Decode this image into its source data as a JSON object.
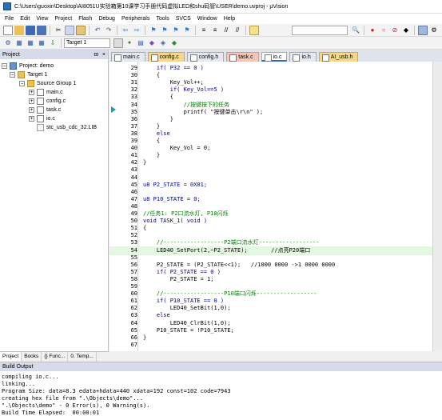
{
  "window": {
    "title": "C:\\Users\\guoxin\\Desktop\\AI8051U实验箱第10课学习手册代码虚拟LED和shu码管\\USER\\demo.uvproj - µVision"
  },
  "menu": [
    "File",
    "Edit",
    "View",
    "Project",
    "Flash",
    "Debug",
    "Peripherals",
    "Tools",
    "SVCS",
    "Window",
    "Help"
  ],
  "toolbar": {
    "target": "Target 1"
  },
  "project_panel": {
    "title": "Project",
    "pin": "ϖ",
    "close": "×",
    "root": "Project: demo",
    "target": "Target 1",
    "group": "Source Group 1",
    "files": [
      "main.c",
      "config.c",
      "task.c",
      "io.c",
      "stc_usb_cdc_32.LIB"
    ],
    "tabs": [
      "Project",
      "Books",
      "{} Func...",
      "0. Temp..."
    ]
  },
  "editor": {
    "tabs": [
      {
        "label": "main.c",
        "color": "#e6e8f0"
      },
      {
        "label": "config.c",
        "color": "#f7d88a"
      },
      {
        "label": "config.h",
        "color": "#e6e8f0"
      },
      {
        "label": "task.c",
        "color": "#f5c6b8"
      },
      {
        "label": "io.c",
        "color": "#ffffff"
      },
      {
        "label": "io.h",
        "color": "#e6e8f0"
      },
      {
        "label": "AI_usb.h",
        "color": "#f7d88a"
      }
    ],
    "lines": [
      {
        "n": "29",
        "t": "    if( P32 == 0 )"
      },
      {
        "n": "30",
        "t": "    {"
      },
      {
        "n": "31",
        "t": "        Key_Vol++;"
      },
      {
        "n": "32",
        "t": "        if( Key_Vol==5 )"
      },
      {
        "n": "33",
        "t": "        {"
      },
      {
        "n": "34",
        "t": "            //按键按下的任务"
      },
      {
        "n": "35",
        "t": "            printf( \"按键单击\\r\\n\" );"
      },
      {
        "n": "36",
        "t": "        }"
      },
      {
        "n": "37",
        "t": "    }"
      },
      {
        "n": "38",
        "t": "    else"
      },
      {
        "n": "39",
        "t": "    {"
      },
      {
        "n": "40",
        "t": "        Key_Vol = 0;"
      },
      {
        "n": "41",
        "t": "    }"
      },
      {
        "n": "42",
        "t": "}"
      },
      {
        "n": "43",
        "t": ""
      },
      {
        "n": "44",
        "t": ""
      },
      {
        "n": "45",
        "t": "u8 P2_STATE = 0X01;"
      },
      {
        "n": "46",
        "t": ""
      },
      {
        "n": "47",
        "t": "u8 P10_STATE = 0;"
      },
      {
        "n": "48",
        "t": ""
      },
      {
        "n": "49",
        "t": "//任务1: P2口流水灯, P10闪烁"
      },
      {
        "n": "50",
        "t": "void TASK_1( void )"
      },
      {
        "n": "51",
        "t": "{"
      },
      {
        "n": "52",
        "t": ""
      },
      {
        "n": "53",
        "t": "    //------------------P2端口流水灯------------------"
      },
      {
        "n": "54",
        "t": "    LED40_SetPort(2,~P2_STATE);       //点亮P20端口"
      },
      {
        "n": "55",
        "t": ""
      },
      {
        "n": "56",
        "t": "    P2_STATE = (P2_STATE<<1);   //1000 0000 ->1 0000 0000"
      },
      {
        "n": "57",
        "t": "    if( P2_STATE == 0 )"
      },
      {
        "n": "58",
        "t": "        P2_STATE = 1;"
      },
      {
        "n": "59",
        "t": ""
      },
      {
        "n": "60",
        "t": "    //------------------P10端口闪烁------------------"
      },
      {
        "n": "61",
        "t": "    if( P10_STATE == 0 )"
      },
      {
        "n": "62",
        "t": "        LED40_SetBit(1,0);"
      },
      {
        "n": "63",
        "t": "    else"
      },
      {
        "n": "64",
        "t": "        LED40_ClrBit(1,0);"
      },
      {
        "n": "65",
        "t": "    P10_STATE = !P10_STATE;"
      },
      {
        "n": "66",
        "t": "}"
      },
      {
        "n": "67",
        "t": ""
      }
    ]
  },
  "build_output": {
    "title": "Build Output",
    "lines": [
      "compiling io.c...",
      "linking...",
      "Program Size: data=8.3 edata+hdata=440 xdata=192 const=102 code=7943",
      "creating hex file from \".\\Objects\\demo\"...",
      "\".\\Objects\\demo\" - 0 Error(s), 0 Warning(s).",
      "Build Time Elapsed:  00:00:01"
    ]
  }
}
